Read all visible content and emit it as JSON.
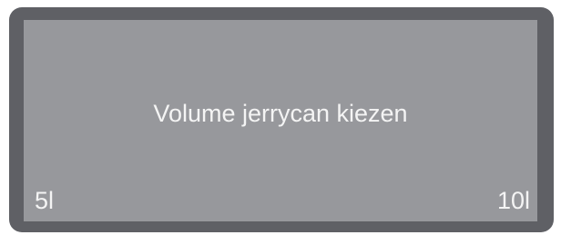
{
  "display": {
    "prompt": "Volume jerrycan kiezen",
    "softkeys": {
      "left": "5l",
      "right": "10l"
    }
  },
  "colors": {
    "bezel": "#5f6065",
    "screen": "#97989c",
    "text": "#f4f4f4"
  }
}
